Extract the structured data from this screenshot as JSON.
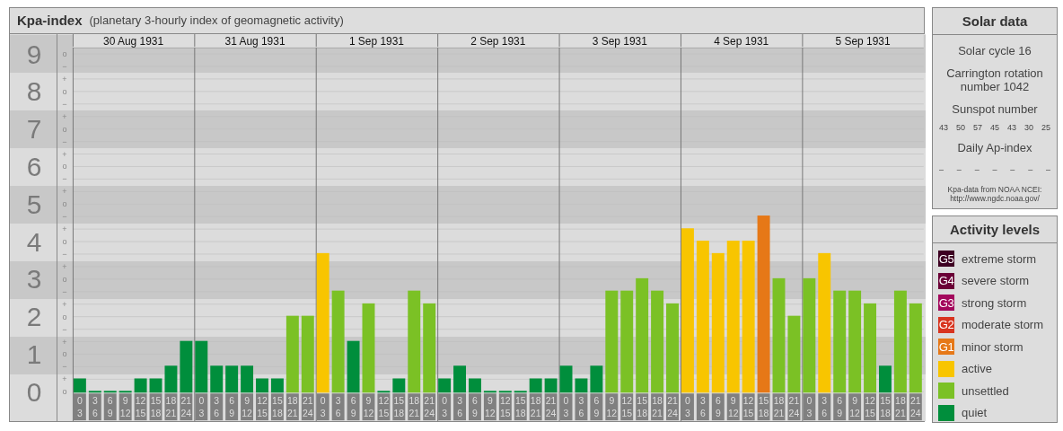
{
  "header": {
    "title": "Kpa-index",
    "subtitle": "(planetary 3-hourly index of geomagnetic activity)"
  },
  "chart": {
    "days": [
      {
        "date": "30 Aug 1931",
        "slots": [
          [
            "0",
            "3"
          ],
          [
            "3",
            "6"
          ],
          [
            "6",
            "9"
          ],
          [
            "9",
            "12"
          ],
          [
            "12",
            "15"
          ],
          [
            "15",
            "18"
          ],
          [
            "18",
            "21"
          ],
          [
            "21",
            "24"
          ]
        ]
      },
      {
        "date": "31 Aug 1931",
        "slots": [
          [
            "0",
            "3"
          ],
          [
            "3",
            "6"
          ],
          [
            "6",
            "9"
          ],
          [
            "9",
            "12"
          ],
          [
            "12",
            "15"
          ],
          [
            "15",
            "18"
          ],
          [
            "18",
            "21"
          ],
          [
            "21",
            "24"
          ]
        ]
      },
      {
        "date": "1 Sep 1931",
        "slots": [
          [
            "0",
            "3"
          ],
          [
            "3",
            "6"
          ],
          [
            "6",
            "9"
          ],
          [
            "9",
            "12"
          ],
          [
            "12",
            "15"
          ],
          [
            "15",
            "18"
          ],
          [
            "18",
            "21"
          ],
          [
            "21",
            "24"
          ]
        ]
      },
      {
        "date": "2 Sep 1931",
        "slots": [
          [
            "0",
            "3"
          ],
          [
            "3",
            "6"
          ],
          [
            "6",
            "9"
          ],
          [
            "9",
            "12"
          ],
          [
            "12",
            "15"
          ],
          [
            "15",
            "18"
          ],
          [
            "18",
            "21"
          ],
          [
            "21",
            "24"
          ]
        ]
      },
      {
        "date": "3 Sep 1931",
        "slots": [
          [
            "0",
            "3"
          ],
          [
            "3",
            "6"
          ],
          [
            "6",
            "9"
          ],
          [
            "9",
            "12"
          ],
          [
            "12",
            "15"
          ],
          [
            "15",
            "18"
          ],
          [
            "18",
            "21"
          ],
          [
            "21",
            "24"
          ]
        ]
      },
      {
        "date": "4 Sep 1931",
        "slots": [
          [
            "0",
            "3"
          ],
          [
            "3",
            "6"
          ],
          [
            "6",
            "9"
          ],
          [
            "9",
            "12"
          ],
          [
            "12",
            "15"
          ],
          [
            "15",
            "18"
          ],
          [
            "18",
            "21"
          ],
          [
            "21",
            "24"
          ]
        ]
      },
      {
        "date": "5 Sep 1931",
        "slots": [
          [
            "0",
            "3"
          ],
          [
            "3",
            "6"
          ],
          [
            "6",
            "9"
          ],
          [
            "9",
            "12"
          ],
          [
            "12",
            "15"
          ],
          [
            "15",
            "18"
          ],
          [
            "18",
            "21"
          ],
          [
            "21",
            "24"
          ]
        ]
      }
    ],
    "minor_marks": [
      "o",
      "−",
      "+",
      "o",
      "−",
      "+",
      "o",
      "−",
      "+",
      "o",
      "−",
      "+",
      "o",
      "−",
      "+",
      "o",
      "−",
      "+",
      "o",
      "−",
      "+",
      "o",
      "−",
      "+",
      "o",
      "−",
      "+",
      "o"
    ],
    "chart_data": {
      "type": "bar",
      "ylim": [
        0,
        9.17
      ],
      "yticks": [
        0,
        1,
        2,
        3,
        4,
        5,
        6,
        7,
        8,
        9
      ],
      "grid": true,
      "values": [
        0.33,
        0,
        0,
        0,
        0.33,
        0.33,
        0.67,
        1.33,
        1.33,
        0.67,
        0.67,
        0.67,
        0.33,
        0.33,
        2,
        2,
        3.67,
        2.67,
        1.33,
        2.33,
        0,
        0.33,
        2.67,
        2.33,
        0.33,
        0.67,
        0.33,
        0,
        0,
        0,
        0.33,
        0.33,
        0.67,
        0.33,
        0.67,
        2.67,
        2.67,
        3,
        2.67,
        2.33,
        4.33,
        4,
        3.67,
        4,
        4,
        4.67,
        3,
        2,
        3,
        3.67,
        2.67,
        2.67,
        2.33,
        0.67,
        2.67,
        2.33
      ]
    }
  },
  "solar_data": {
    "title": "Solar data",
    "solar_cycle": "Solar cycle 16",
    "carrington": "Carrington rotation number 1042",
    "sunspot_label": "Sunspot number",
    "sunspot_numbers": [
      "43",
      "50",
      "57",
      "45",
      "43",
      "30",
      "25"
    ],
    "ap_label": "Daily Ap-index",
    "ap_values": [
      "–",
      "–",
      "–",
      "–",
      "–",
      "–",
      "–"
    ],
    "source": "Kpa-data from NOAA NCEI:",
    "source_url": "http://www.ngdc.noaa.gov/"
  },
  "activity_levels": {
    "title": "Activity levels",
    "items": [
      {
        "code": "G5",
        "label": "extreme storm",
        "color": "#3d0021"
      },
      {
        "code": "G4",
        "label": "severe storm",
        "color": "#6b0036"
      },
      {
        "code": "G3",
        "label": "strong storm",
        "color": "#a3085c"
      },
      {
        "code": "G2",
        "label": "moderate storm",
        "color": "#d8341f"
      },
      {
        "code": "G1",
        "label": "minor storm",
        "color": "#e67817"
      },
      {
        "label": "active",
        "color": "#f8c500"
      },
      {
        "label": "unsettled",
        "color": "#7bc125"
      },
      {
        "label": "quiet",
        "color": "#008e3c"
      }
    ]
  }
}
